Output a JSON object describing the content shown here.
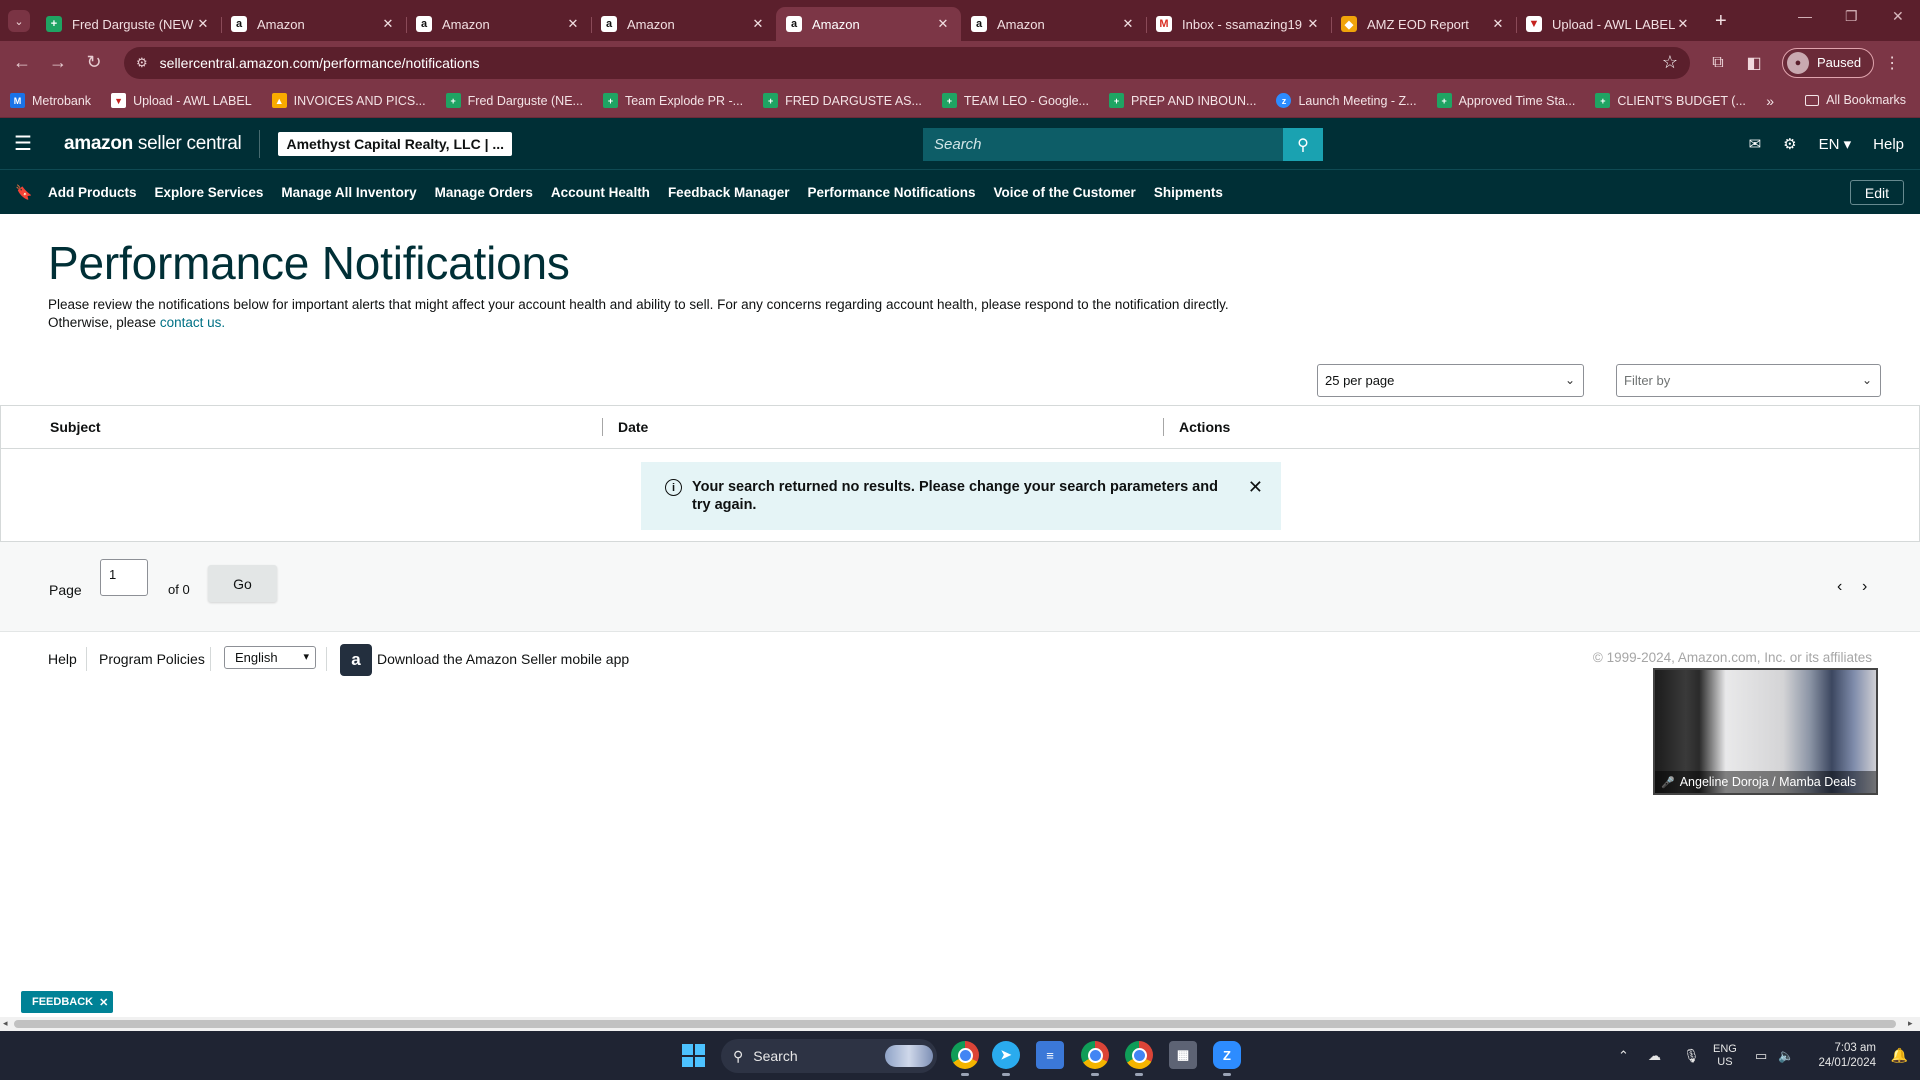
{
  "browser": {
    "tabs": [
      {
        "title": "Fred Darguste (NEW",
        "favicon": "sheets-icon",
        "active": false
      },
      {
        "title": "Amazon",
        "favicon": "amazon-icon",
        "active": false
      },
      {
        "title": "Amazon",
        "favicon": "amazon-icon",
        "active": false
      },
      {
        "title": "Amazon",
        "favicon": "amazon-icon",
        "active": false
      },
      {
        "title": "Amazon",
        "favicon": "amazon-icon",
        "active": true
      },
      {
        "title": "Amazon",
        "favicon": "amazon-icon",
        "active": false
      },
      {
        "title": "Inbox - ssamazing19",
        "favicon": "gmail-icon",
        "active": false
      },
      {
        "title": "AMZ EOD Report",
        "favicon": "report-icon",
        "active": false
      },
      {
        "title": "Upload - AWL LABEL",
        "favicon": "upload-icon",
        "active": false
      }
    ],
    "url": "sellercentral.amazon.com/performance/notifications",
    "profile_status": "Paused",
    "bookmarks": [
      {
        "label": "Metrobank",
        "icon": "bank-icon"
      },
      {
        "label": "Upload - AWL LABEL",
        "icon": "upload-icon"
      },
      {
        "label": "INVOICES AND PICS...",
        "icon": "drive-icon"
      },
      {
        "label": "Fred Darguste (NE...",
        "icon": "sheets-icon"
      },
      {
        "label": "Team Explode PR -...",
        "icon": "sheets-icon"
      },
      {
        "label": "FRED DARGUSTE AS...",
        "icon": "sheets-icon"
      },
      {
        "label": "TEAM LEO - Google...",
        "icon": "sheets-icon"
      },
      {
        "label": "PREP AND INBOUN...",
        "icon": "sheets-icon"
      },
      {
        "label": "Launch Meeting - Z...",
        "icon": "zoom-icon"
      },
      {
        "label": "Approved Time Sta...",
        "icon": "sheets-icon"
      },
      {
        "label": "CLIENT'S BUDGET (...",
        "icon": "sheets-icon"
      }
    ],
    "all_bookmarks": "All Bookmarks"
  },
  "header": {
    "logo_bold": "amazon",
    "logo_rest": " seller central",
    "account": "Amethyst Capital Realty, LLC | ...",
    "search_placeholder": "Search",
    "language": "EN",
    "help": "Help"
  },
  "nav": {
    "items": [
      "Add Products",
      "Explore Services",
      "Manage All Inventory",
      "Manage Orders",
      "Account Health",
      "Feedback Manager",
      "Performance Notifications",
      "Voice of the Customer",
      "Shipments"
    ],
    "edit": "Edit"
  },
  "main": {
    "title": "Performance Notifications",
    "description": "Please review the notifications below for important alerts that might affect your account health and ability to sell. For any concerns regarding account health, please respond to the notification directly. Otherwise, please ",
    "contact_link": "contact us.",
    "per_page": "25 per page",
    "filter_placeholder": "Filter by",
    "columns": [
      "Subject",
      "Date",
      "Actions"
    ],
    "empty_message": "Your search returned no results. Please change your search parameters and try again.",
    "pager": {
      "page_label": "Page",
      "page_value": "1",
      "of_label": "of 0",
      "go": "Go"
    }
  },
  "footer": {
    "help": "Help",
    "program_policies": "Program Policies",
    "language": "English",
    "app_text": "Download the Amazon Seller mobile app",
    "copyright": "© 1999-2024, Amazon.com, Inc. or its affiliates"
  },
  "video_overlay": {
    "name": "Angeline Doroja / Mamba Deals"
  },
  "feedback": "FEEDBACK",
  "taskbar": {
    "search": "Search",
    "lang_line1": "ENG",
    "lang_line2": "US",
    "time": "7:03 am",
    "date": "24/01/2024"
  },
  "colors": {
    "header_bg": "#002f36",
    "browser_frame": "#7c3646",
    "search_button": "#1aa2b1",
    "alert_bg": "#e5f4f6"
  }
}
